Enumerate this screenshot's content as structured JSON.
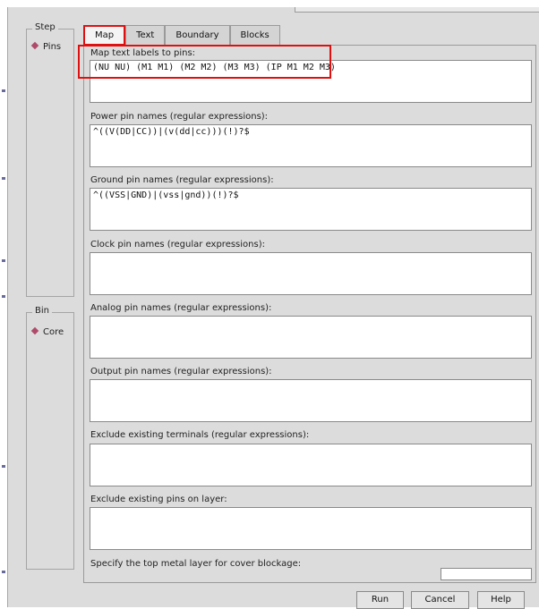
{
  "sidebar": {
    "step_label": "Step",
    "step_item": "Pins",
    "bin_label": "Bin",
    "bin_item": "Core"
  },
  "tabs": [
    "Map",
    "Text",
    "Boundary",
    "Blocks"
  ],
  "fields": [
    {
      "label": "Map text labels to pins:",
      "value": "(NU NU) (M1 M1) (M2 M2) (M3 M3) (IP M1 M2 M3)"
    },
    {
      "label": "Power pin names (regular expressions):",
      "value": "^((V(DD|CC))|(v(dd|cc)))(!)?$"
    },
    {
      "label": "Ground pin names (regular expressions):",
      "value": "^((VSS|GND)|(vss|gnd))(!)?$"
    },
    {
      "label": "Clock pin names (regular expressions):",
      "value": ""
    },
    {
      "label": "Analog pin names (regular expressions):",
      "value": ""
    },
    {
      "label": "Output pin names (regular expressions):",
      "value": ""
    },
    {
      "label": "Exclude existing terminals (regular expressions):",
      "value": ""
    },
    {
      "label": "Exclude existing pins on layer:",
      "value": ""
    }
  ],
  "top_metal": {
    "label": "Specify the top metal layer for cover blockage:",
    "value": ""
  },
  "buttons": {
    "run": "Run",
    "cancel": "Cancel",
    "help": "Help"
  },
  "colors": {
    "highlight": "#e01010",
    "radio": "#b04a6a",
    "background": "#dcdcdc"
  }
}
